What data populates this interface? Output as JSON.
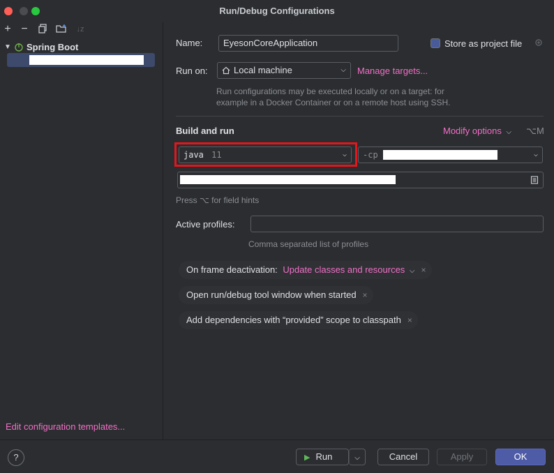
{
  "window": {
    "title": "Run/Debug Configurations"
  },
  "sidebar": {
    "group_label": "Spring Boot",
    "edit_templates": "Edit configuration templates..."
  },
  "form": {
    "name_label": "Name:",
    "name_value": "EyesonCoreApplication",
    "store_label": "Store as project file",
    "run_on_label": "Run on:",
    "run_on_value": "Local machine",
    "manage_targets": "Manage targets...",
    "run_on_hint_1": "Run configurations may be executed locally or on a target: for",
    "run_on_hint_2": "example in a Docker Container or on a remote host using SSH.",
    "build_run_title": "Build and run",
    "modify_options": "Modify options",
    "modify_shortcut": "⌥M",
    "jdk_keyword": "java",
    "jdk_version": "11",
    "cp_prefix": "-cp",
    "field_hints": "Press ⌥ for field hints",
    "active_profiles_label": "Active profiles:",
    "active_profiles_value": "",
    "active_profiles_hint": "Comma separated list of profiles"
  },
  "chips": {
    "frame_deactivation_label": "On frame deactivation:",
    "frame_deactivation_value": "Update classes and resources",
    "open_tool_window": "Open run/debug tool window when started",
    "add_dependencies": "Add dependencies with “provided” scope to classpath"
  },
  "buttons": {
    "help": "?",
    "run": "Run",
    "cancel": "Cancel",
    "apply": "Apply",
    "ok": "OK"
  },
  "colors": {
    "accent_link": "#f170c7",
    "highlight_box": "#e3161b",
    "primary_button": "#4e5ba6"
  }
}
